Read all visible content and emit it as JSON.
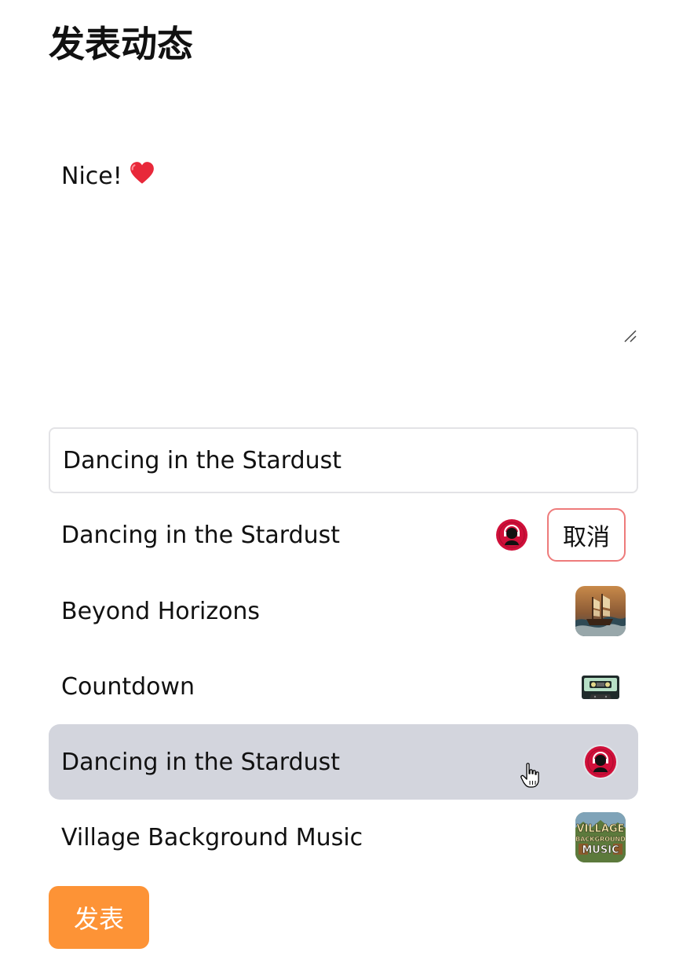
{
  "page": {
    "title": "发表动态"
  },
  "post": {
    "text": "Nice!",
    "emoji_icon": "red-heart-icon"
  },
  "music_search": {
    "value": "Dancing in the Stardust"
  },
  "selected_song": {
    "title": "Dancing in the Stardust",
    "cover_icon": "record-headphone-cover",
    "cancel_label": "取消"
  },
  "song_list": [
    {
      "title": "Beyond Horizons",
      "cover": "pirate-ship-cover"
    },
    {
      "title": "Countdown",
      "cover": "cassette-tape-cover"
    },
    {
      "title": "Dancing in the Stardust",
      "cover": "record-headphone-cover",
      "hovered": true
    },
    {
      "title": "Village Background Music",
      "cover": "village-music-cover",
      "cover_text": [
        "VILLAGE",
        "BACKGROUND",
        "MUSIC"
      ]
    }
  ],
  "publish": {
    "label": "发表"
  },
  "colors": {
    "publish_bg": "#fd9336",
    "cancel_border": "#ee7b7b",
    "hover_bg": "#d3d5dd",
    "input_border": "#e3e3e6"
  }
}
